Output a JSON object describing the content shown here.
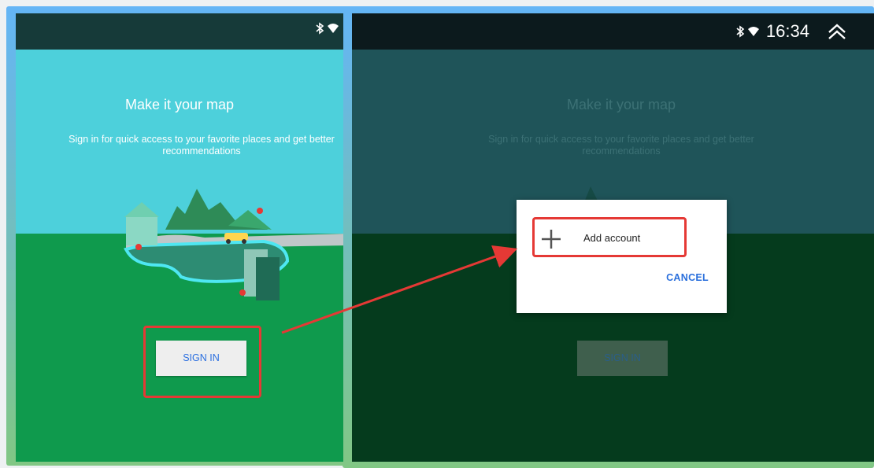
{
  "left_screen": {
    "title": "Make it your map",
    "subtitle": "Sign in for quick access to your favorite places and get better recommendations",
    "signin_label": "SIGN IN",
    "status_icons": [
      "bluetooth-icon",
      "wifi-icon"
    ]
  },
  "right_screen": {
    "title": "Make it your map",
    "subtitle": "Sign in for quick access to your favorite places and get better recommendations",
    "signin_label": "SIGN IN",
    "status": {
      "time": "16:34",
      "icons": [
        "bluetooth-icon",
        "wifi-icon",
        "chevron-up-icon"
      ]
    },
    "dialog": {
      "add_account_label": "Add account",
      "cancel_label": "CANCEL",
      "add_icon": "plus-icon"
    }
  },
  "annotation": {
    "highlight_color": "#e53935",
    "arrow_color": "#e53935"
  },
  "colors": {
    "sky": "#4dd0db",
    "ground": "#0f9a4d",
    "accent_blue": "#2b6fe0"
  }
}
